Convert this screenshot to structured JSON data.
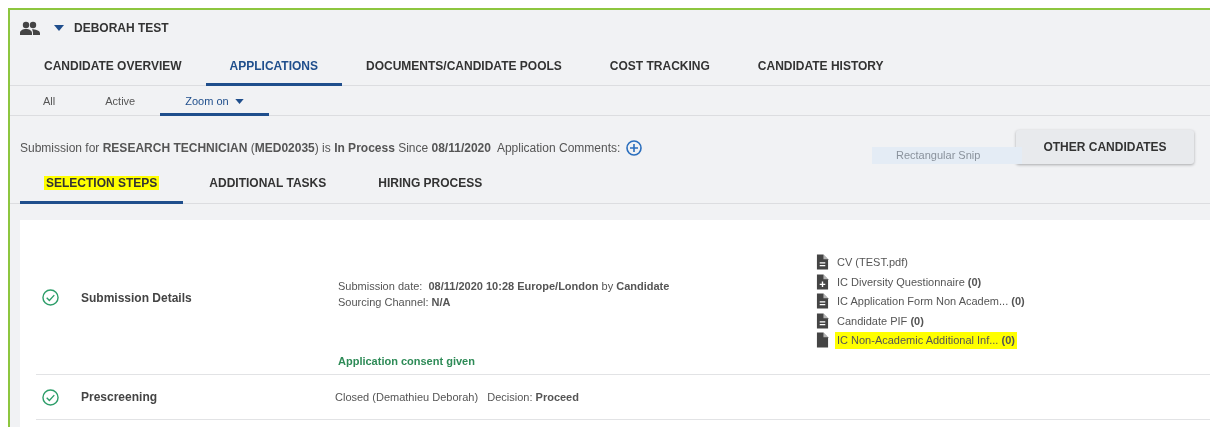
{
  "header": {
    "candidate_name": "DEBORAH TEST"
  },
  "tabs": [
    {
      "label": "CANDIDATE OVERVIEW",
      "selected": false
    },
    {
      "label": "APPLICATIONS",
      "selected": true
    },
    {
      "label": "DOCUMENTS/CANDIDATE POOLS",
      "selected": false
    },
    {
      "label": "COST TRACKING",
      "selected": false
    },
    {
      "label": "CANDIDATE HISTORY",
      "selected": false
    }
  ],
  "filters": [
    {
      "label": "All",
      "selected": false,
      "dropdown": false
    },
    {
      "label": "Active",
      "selected": false,
      "dropdown": false
    },
    {
      "label": "Zoom on",
      "selected": true,
      "dropdown": true
    }
  ],
  "submission_summary": "Submission for **RESEARCH TECHNICIAN** (**MED02035**) is **In Process** Since **08/11/2020**",
  "comments_label": "Application Comments:",
  "snip_tooltip": "Rectangular Snip",
  "other_candidates_button": "OTHER CANDIDATES",
  "step_tabs": [
    {
      "label": "SELECTION STEPS",
      "selected": true,
      "highlighted": true
    },
    {
      "label": "ADDITIONAL TASKS",
      "selected": false,
      "highlighted": false
    },
    {
      "label": "HIRING PROCESS",
      "selected": false,
      "highlighted": false
    }
  ],
  "steps": [
    {
      "name": "Submission Details",
      "completed": true,
      "details": [
        "Submission date:  **08/11/2020 10:28 Europe/London** by **Candidate**",
        "Sourcing Channel: **N/A**"
      ],
      "consent": "Application consent given",
      "documents": [
        {
          "kind": "lines",
          "label": "CV (TEST.pdf)",
          "highlighted": false
        },
        {
          "kind": "plus",
          "label": "IC Diversity Questionnaire **(0)**",
          "highlighted": false
        },
        {
          "kind": "lines",
          "label": "IC Application Form Non Academ... **(0)**",
          "highlighted": false
        },
        {
          "kind": "lines",
          "label": "Candidate PIF **(0)**",
          "highlighted": false
        },
        {
          "kind": "blank",
          "label": "IC Non-Academic Additional Inf... **(0)**",
          "highlighted": true
        }
      ]
    },
    {
      "name": "Prescreening",
      "completed": true,
      "details": [
        "Closed (Demathieu Deborah)   Decision: **Proceed**"
      ]
    }
  ]
}
